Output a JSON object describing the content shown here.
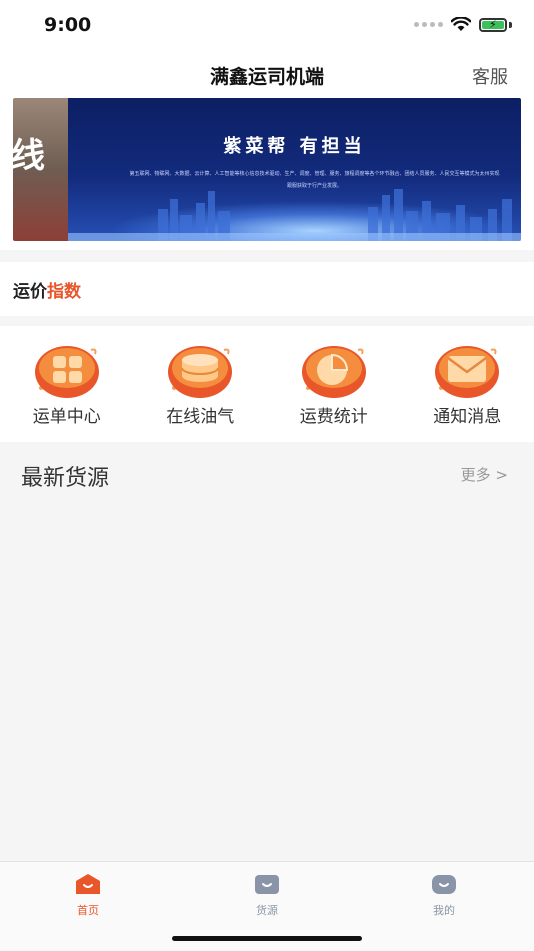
{
  "status_bar": {
    "time": "9:00"
  },
  "nav": {
    "title": "满鑫运司机端",
    "service_label": "客服"
  },
  "banner": {
    "left_mark": "线",
    "title": "紫菜帮 有担当",
    "subtitle": "第五联网、物联网、大数据、云计算、人工智能等核心信息技术驱动、生产、调度、管理、服务、旅程调度等各个环节融合、团结人员服务、人民交互等模式为太州实现跟服获取于行产业发展。"
  },
  "freight_index": {
    "title_prefix": "运价",
    "title_highlight": "指数"
  },
  "menu": [
    {
      "label": "运单中心",
      "icon": "waybill-grid-icon"
    },
    {
      "label": "在线油气",
      "icon": "fuel-cylinder-icon"
    },
    {
      "label": "运费统计",
      "icon": "pie-chart-icon"
    },
    {
      "label": "通知消息",
      "icon": "envelope-icon"
    }
  ],
  "latest_cargo": {
    "title": "最新货源",
    "more_label": "更多 >"
  },
  "tab_bar": [
    {
      "label": "首页",
      "icon": "home-icon",
      "active": true
    },
    {
      "label": "货源",
      "icon": "cargo-icon",
      "active": false
    },
    {
      "label": "我的",
      "icon": "profile-icon",
      "active": false
    }
  ],
  "colors": {
    "accent": "#e8562a",
    "inactive": "#8a94a8"
  }
}
